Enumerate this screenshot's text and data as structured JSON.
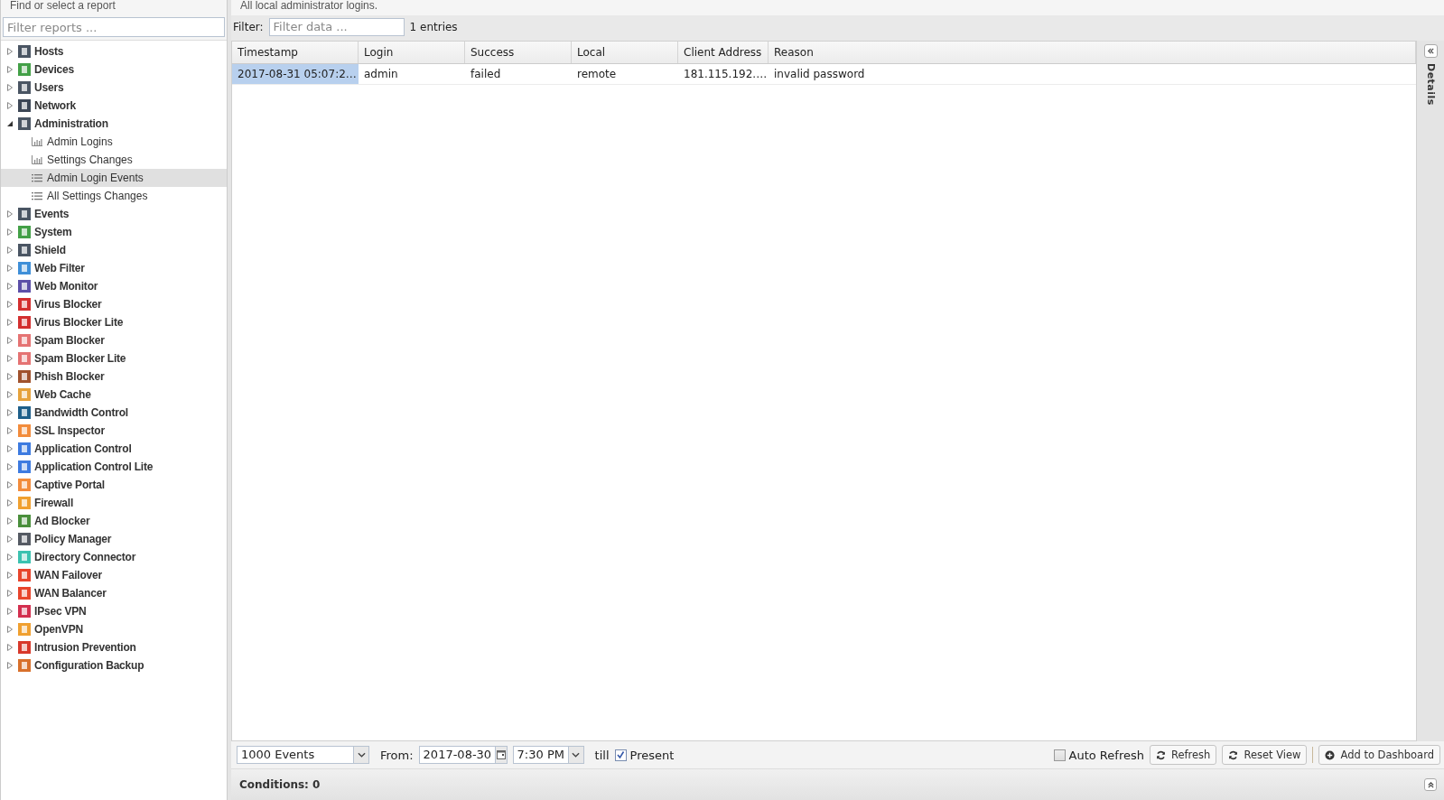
{
  "sidebar": {
    "header": "Find or select a report",
    "filter": {
      "placeholder": "Filter reports ..."
    },
    "tree": [
      {
        "label": "Hosts",
        "color": "#4a5563",
        "expanded": false,
        "selected": false
      },
      {
        "label": "Devices",
        "color": "#43a047",
        "expanded": false,
        "selected": false
      },
      {
        "label": "Users",
        "color": "#4a5563",
        "expanded": false,
        "selected": false
      },
      {
        "label": "Network",
        "color": "#3d4756",
        "expanded": false,
        "selected": false
      },
      {
        "label": "Administration",
        "color": "#4a5563",
        "expanded": true,
        "selected": false,
        "children": [
          {
            "label": "Admin Logins",
            "kind": "chart",
            "selected": false
          },
          {
            "label": "Settings Changes",
            "kind": "chart",
            "selected": false
          },
          {
            "label": "Admin Login Events",
            "kind": "list",
            "selected": true
          },
          {
            "label": "All Settings Changes",
            "kind": "list",
            "selected": false
          }
        ]
      },
      {
        "label": "Events",
        "color": "#4a5563",
        "expanded": false,
        "selected": false
      },
      {
        "label": "System",
        "color": "#43a047",
        "expanded": false,
        "selected": false
      },
      {
        "label": "Shield",
        "color": "#4a5563",
        "expanded": false,
        "selected": false
      },
      {
        "label": "Web Filter",
        "color": "#3f8fd8",
        "expanded": false,
        "selected": false
      },
      {
        "label": "Web Monitor",
        "color": "#5c4fa8",
        "expanded": false,
        "selected": false
      },
      {
        "label": "Virus Blocker",
        "color": "#d32f2f",
        "expanded": false,
        "selected": false
      },
      {
        "label": "Virus Blocker Lite",
        "color": "#d32f2f",
        "expanded": false,
        "selected": false
      },
      {
        "label": "Spam Blocker",
        "color": "#e57373",
        "expanded": false,
        "selected": false
      },
      {
        "label": "Spam Blocker Lite",
        "color": "#e57373",
        "expanded": false,
        "selected": false
      },
      {
        "label": "Phish Blocker",
        "color": "#a0522d",
        "expanded": false,
        "selected": false
      },
      {
        "label": "Web Cache",
        "color": "#e6a23c",
        "expanded": false,
        "selected": false
      },
      {
        "label": "Bandwidth Control",
        "color": "#1e5f8a",
        "expanded": false,
        "selected": false
      },
      {
        "label": "SSL Inspector",
        "color": "#f28c3c",
        "expanded": false,
        "selected": false
      },
      {
        "label": "Application Control",
        "color": "#3d7be0",
        "expanded": false,
        "selected": false
      },
      {
        "label": "Application Control Lite",
        "color": "#3d7be0",
        "expanded": false,
        "selected": false
      },
      {
        "label": "Captive Portal",
        "color": "#f28c3c",
        "expanded": false,
        "selected": false
      },
      {
        "label": "Firewall",
        "color": "#f0a030",
        "expanded": false,
        "selected": false
      },
      {
        "label": "Ad Blocker",
        "color": "#4a8f3c",
        "expanded": false,
        "selected": false
      },
      {
        "label": "Policy Manager",
        "color": "#555a63",
        "expanded": false,
        "selected": false
      },
      {
        "label": "Directory Connector",
        "color": "#3cc2b0",
        "expanded": false,
        "selected": false
      },
      {
        "label": "WAN Failover",
        "color": "#e8452c",
        "expanded": false,
        "selected": false
      },
      {
        "label": "WAN Balancer",
        "color": "#e8452c",
        "expanded": false,
        "selected": false
      },
      {
        "label": "IPsec VPN",
        "color": "#d32f4f",
        "expanded": false,
        "selected": false
      },
      {
        "label": "OpenVPN",
        "color": "#f0a030",
        "expanded": false,
        "selected": false
      },
      {
        "label": "Intrusion Prevention",
        "color": "#d8392b",
        "expanded": false,
        "selected": false
      },
      {
        "label": "Configuration Backup",
        "color": "#d8702b",
        "expanded": false,
        "selected": false
      }
    ]
  },
  "report": {
    "description": "All local administrator logins.",
    "filter": {
      "label": "Filter:",
      "placeholder": "Filter data ..."
    },
    "entries": "1 entries"
  },
  "table": {
    "columns": [
      "Timestamp",
      "Login",
      "Success",
      "Local",
      "Client Address",
      "Reason"
    ],
    "rows": [
      {
        "cells": [
          {
            "text": "2017-08-31 05:07:2…",
            "selected": true
          },
          {
            "text": "admin",
            "selected": false
          },
          {
            "text": "failed",
            "selected": false
          },
          {
            "text": "remote",
            "selected": false
          },
          {
            "text": "181.115.192.…",
            "selected": false
          },
          {
            "text": "invalid password",
            "selected": false
          }
        ]
      }
    ]
  },
  "details_panel": {
    "title": "Details"
  },
  "toolbar": {
    "limit": "1000 Events",
    "from_label": "From:",
    "date": "2017-08-30",
    "time": "7:30 PM",
    "till_label": "till",
    "present": {
      "label": "Present",
      "checked": true
    },
    "auto_refresh": {
      "label": "Auto Refresh",
      "checked": false
    },
    "buttons": [
      {
        "label": "Refresh",
        "kind": "refresh"
      },
      {
        "label": "Reset View",
        "kind": "refresh"
      },
      {
        "label": "Add to Dashboard",
        "kind": "add"
      }
    ]
  },
  "conditions": {
    "label": "Conditions: 0"
  }
}
